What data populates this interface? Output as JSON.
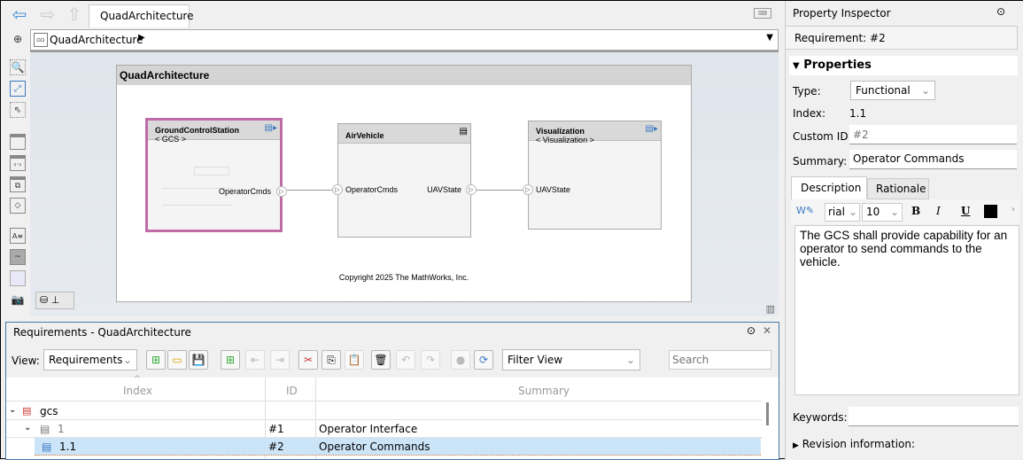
{
  "nav": {
    "tab": "QuadArchitecture",
    "breadcrumb": "QuadArchitecture"
  },
  "diagram": {
    "title": "QuadArchitecture",
    "copyright": "Copyright 2025 The MathWorks, Inc.",
    "components": [
      {
        "name": "GroundControlStation",
        "stereotype": "< GCS >",
        "port_out": "OperatorCmds"
      },
      {
        "name": "AirVehicle",
        "port_in": "OperatorCmds",
        "port_out": "UAVState"
      },
      {
        "name": "Visualization",
        "stereotype": "< Visualization >",
        "port_in": "UAVState"
      }
    ]
  },
  "requirements": {
    "title": "Requirements - QuadArchitecture",
    "view_label": "View:",
    "view_value": "Requirements",
    "filter_value": "Filter View",
    "search_placeholder": "Search",
    "columns": [
      "Index",
      "ID",
      "Summary"
    ],
    "rows": [
      {
        "index": "gcs",
        "id": "",
        "summary": ""
      },
      {
        "index": "1",
        "id": "#1",
        "summary": "Operator Interface"
      },
      {
        "index": "1.1",
        "id": "#2",
        "summary": "Operator Commands"
      }
    ]
  },
  "inspector": {
    "title": "Property Inspector",
    "header": "Requirement: #2",
    "section": "Properties",
    "type_label": "Type:",
    "type_value": "Functional",
    "index_label": "Index:",
    "index_value": "1.1",
    "custom_id_label": "Custom ID:",
    "custom_id_placeholder": "#2",
    "summary_label": "Summary:",
    "summary_value": "Operator Commands",
    "tabs": [
      "Description",
      "Rationale"
    ],
    "font": "rial",
    "font_size": "10",
    "bold": "B",
    "italic": "I",
    "underline": "U",
    "description": "The GCS shall provide capability for an operator to send commands to the vehicle.",
    "keywords_label": "Keywords:",
    "revision_label": "Revision information:"
  },
  "colors": {
    "selection": "#cce4f7",
    "highlight": "#c06aa8",
    "accent": "#3a78c2"
  }
}
